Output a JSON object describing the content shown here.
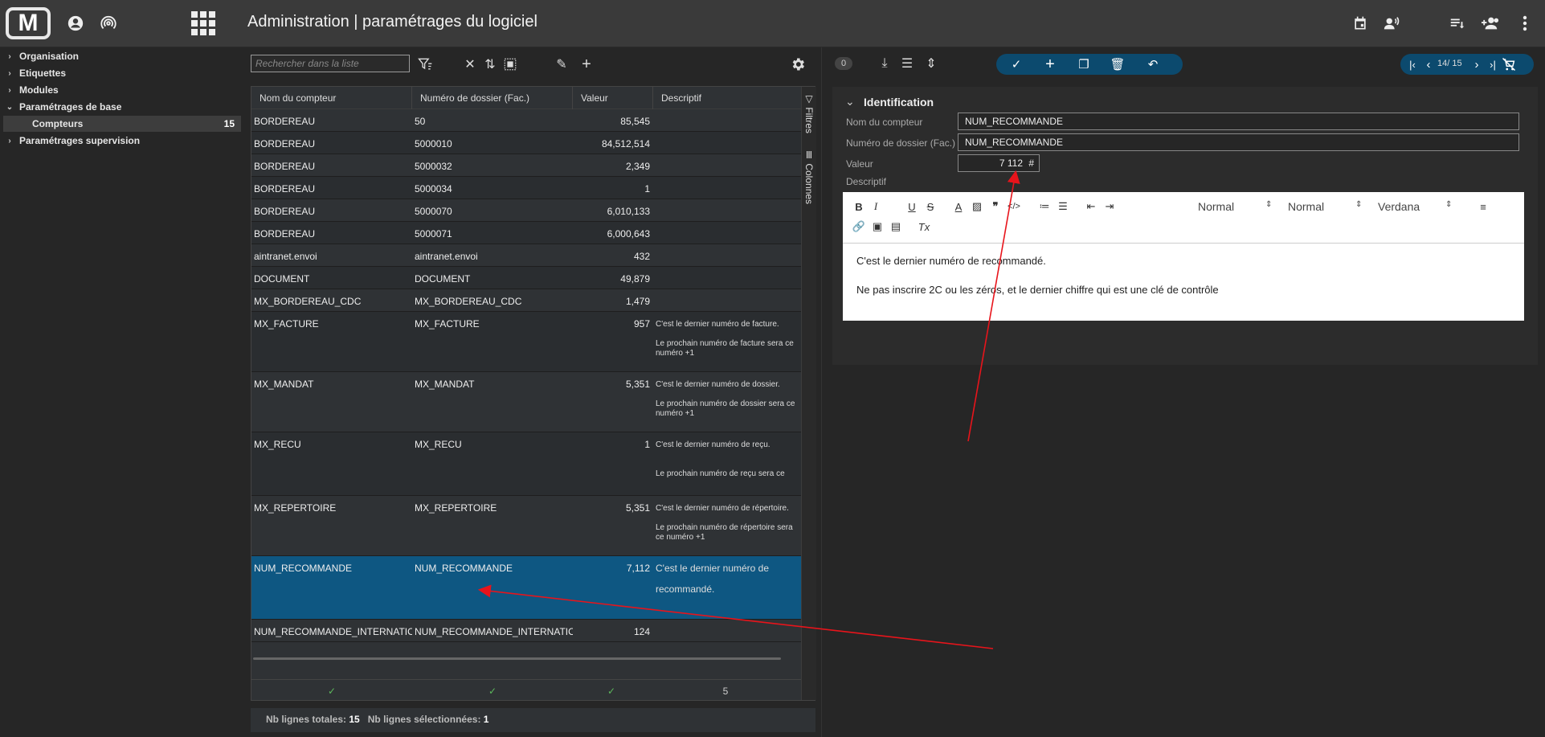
{
  "app": {
    "title": "Administration | paramétrages du logiciel",
    "logo_text": "M"
  },
  "sidebar": {
    "items": [
      {
        "label": "Organisation",
        "expanded": false
      },
      {
        "label": "Etiquettes",
        "expanded": false
      },
      {
        "label": "Modules",
        "expanded": false
      },
      {
        "label": "Paramétrages de base",
        "expanded": true
      },
      {
        "label": "Compteurs",
        "count": "15",
        "selected": true
      },
      {
        "label": "Paramétrages supervision",
        "expanded": false
      }
    ]
  },
  "list": {
    "search_placeholder": "Rechercher dans la liste",
    "columns": [
      "Nom du compteur",
      "Numéro de dossier (Fac.)",
      "Valeur",
      "Descriptif"
    ],
    "side_tabs": [
      "Filtres",
      "Colonnes"
    ],
    "rows": [
      {
        "name": "BORDEREAU",
        "dossier": "50",
        "valeur": "85,545",
        "desc": ""
      },
      {
        "name": "BORDEREAU",
        "dossier": "5000010",
        "valeur": "84,512,514",
        "desc": ""
      },
      {
        "name": "BORDEREAU",
        "dossier": "5000032",
        "valeur": "2,349",
        "desc": ""
      },
      {
        "name": "BORDEREAU",
        "dossier": "5000034",
        "valeur": "1",
        "desc": ""
      },
      {
        "name": "BORDEREAU",
        "dossier": "5000070",
        "valeur": "6,010,133",
        "desc": ""
      },
      {
        "name": "BORDEREAU",
        "dossier": "5000071",
        "valeur": "6,000,643",
        "desc": ""
      },
      {
        "name": "aintranet.envoi",
        "dossier": "aintranet.envoi",
        "valeur": "432",
        "desc": ""
      },
      {
        "name": "DOCUMENT",
        "dossier": "DOCUMENT",
        "valeur": "49,879",
        "desc": ""
      },
      {
        "name": "MX_BORDEREAU_CDC",
        "dossier": "MX_BORDEREAU_CDC",
        "valeur": "1,479",
        "desc": ""
      },
      {
        "name": "MX_FACTURE",
        "dossier": "MX_FACTURE",
        "valeur": "957",
        "desc": "C'est le dernier numéro de facture.\n\nLe prochain numéro de facture sera ce numéro +1"
      },
      {
        "name": "MX_MANDAT",
        "dossier": "MX_MANDAT",
        "valeur": "5,351",
        "desc": "C'est le dernier numéro de dossier.\n\nLe prochain numéro de dossier sera ce numéro +1"
      },
      {
        "name": "MX_RECU",
        "dossier": "MX_RECU",
        "valeur": "1",
        "desc": "C'est le dernier numéro de reçu.\n\n\nLe prochain numéro de reçu sera ce"
      },
      {
        "name": "MX_REPERTOIRE",
        "dossier": "MX_REPERTOIRE",
        "valeur": "5,351",
        "desc": "C'est le dernier numéro de répertoire.\n\nLe prochain numéro de répertoire sera ce numéro +1"
      },
      {
        "name": "NUM_RECOMMANDE",
        "dossier": "NUM_RECOMMANDE",
        "valeur": "7,112",
        "desc": "C'est le dernier numéro de recommandé."
      },
      {
        "name": "NUM_RECOMMANDE_INTERNATIO...",
        "dossier": "NUM_RECOMMANDE_INTERNATIO...",
        "valeur": "124",
        "desc": ""
      }
    ],
    "footer_count": "5",
    "status": {
      "total_label": "Nb lignes totales:",
      "total": "15",
      "selected_label": "Nb lignes sélectionnées:",
      "selected": "1"
    }
  },
  "detail": {
    "badge": "0",
    "nav": {
      "position": "14/ 15"
    },
    "section_title": "Identification",
    "fields": {
      "nom_label": "Nom du compteur",
      "nom_value": "NUM_RECOMMANDE",
      "dossier_label": "Numéro de dossier (Fac.)",
      "dossier_value": "NUM_RECOMMANDE",
      "valeur_label": "Valeur",
      "valeur_value": "7 112",
      "valeur_suffix": "#",
      "desc_label": "Descriptif"
    },
    "editor": {
      "select1": "Normal",
      "select2": "Normal",
      "font": "Verdana",
      "line1": "C'est le dernier numéro de recommandé.",
      "line2": "Ne pas inscrire 2C ou les zéros, et le dernier chiffre qui est une clé de contrôle"
    }
  },
  "colors": {
    "accent": "#0e5782",
    "toolbar_pill": "#0c4a6e",
    "annotation": "#e8141b",
    "check": "#5cb85c"
  }
}
